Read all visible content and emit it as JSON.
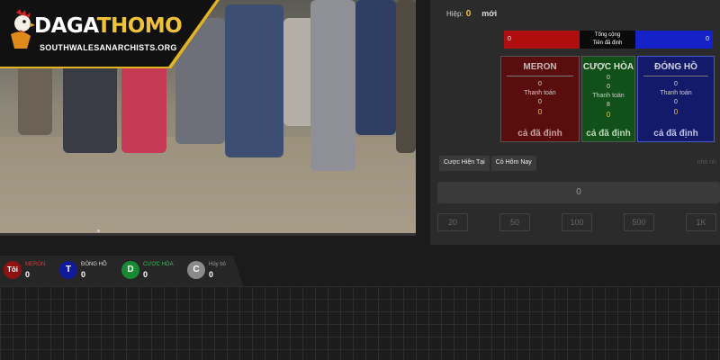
{
  "logo": {
    "title_a": "DAGA",
    "title_b": "THOMO",
    "subtitle": "SOUTHWALESANARCHISTS.ORG"
  },
  "round": {
    "label": "Hiệp:",
    "number": "0",
    "status": "mới"
  },
  "totals": {
    "meron": "0",
    "title_line1": "Tổng cộng",
    "title_line2": "Tiền đã định",
    "dong_ho": "0"
  },
  "bets": {
    "meron": {
      "name": "MERON",
      "v1": "0",
      "label": "Thanh toán",
      "v2": "0",
      "v3": "0",
      "fixed": "cả đã định"
    },
    "cuoc_hoa": {
      "name": "CƯỢC HÒA",
      "v0": "0",
      "v1": "0",
      "label": "Thanh toán",
      "v2": "8",
      "v3": "0",
      "fixed": "cả đã định"
    },
    "dong_ho": {
      "name": "ĐÓNG HỒ",
      "v1": "0",
      "label": "Thanh toán",
      "v2": "0",
      "v3": "0",
      "fixed": "cả đã định"
    }
  },
  "tabs": [
    "Cược Hiện Tại",
    "Cỏ Hôm Nay"
  ],
  "ghost_label": "nhỏ nh",
  "amount": "0",
  "chips": [
    "20",
    "50",
    "100",
    "500",
    "1K"
  ],
  "stats": [
    {
      "letter": "Tôi",
      "label": "MERON",
      "value": "0",
      "color": "#8e1212",
      "label_color": "#d83a3a"
    },
    {
      "letter": "T",
      "label": "ĐÓNG HỒ",
      "value": "0",
      "color": "#101a9a",
      "label_color": "#dddddd"
    },
    {
      "letter": "D",
      "label": "CƯỢC HÒA",
      "value": "0",
      "color": "#178a33",
      "label_color": "#3cc25a"
    },
    {
      "letter": "C",
      "label": "Hủy bỏ",
      "value": "0",
      "color": "#8a8a8a",
      "label_color": "#999999"
    }
  ]
}
